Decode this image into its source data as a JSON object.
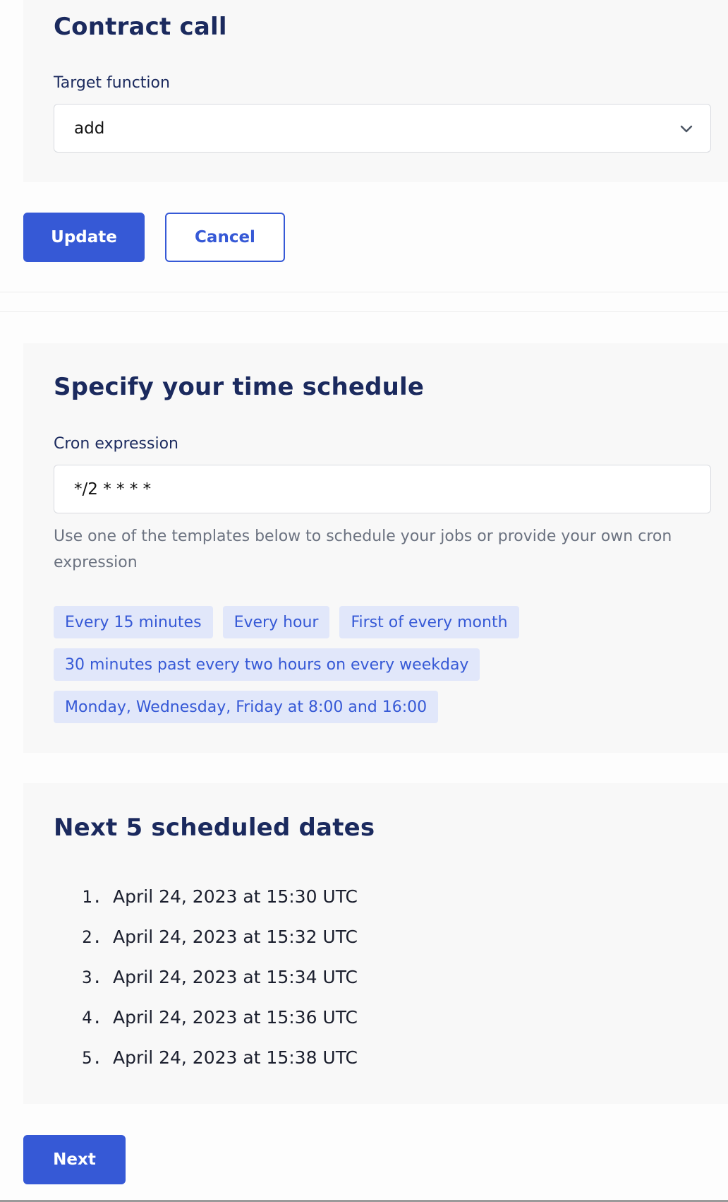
{
  "contract_call": {
    "title": "Contract call",
    "target_function_label": "Target function",
    "target_function_value": "add"
  },
  "actions": {
    "update_label": "Update",
    "cancel_label": "Cancel"
  },
  "schedule": {
    "title": "Specify your time schedule",
    "cron_label": "Cron expression",
    "cron_value": "*/2 * * * *",
    "help_text": "Use one of the templates below to schedule your jobs or provide your own cron expression",
    "templates": [
      "Every 15 minutes",
      "Every hour",
      "First of every month",
      "30 minutes past every two hours on every weekday",
      "Monday, Wednesday, Friday at 8:00 and 16:00"
    ]
  },
  "next_dates": {
    "title": "Next 5 scheduled dates",
    "items": [
      {
        "num": "1.",
        "date": "April 24, 2023 at 15:30 UTC"
      },
      {
        "num": "2.",
        "date": "April 24, 2023 at 15:32 UTC"
      },
      {
        "num": "3.",
        "date": "April 24, 2023 at 15:34 UTC"
      },
      {
        "num": "4.",
        "date": "April 24, 2023 at 15:36 UTC"
      },
      {
        "num": "5.",
        "date": "April 24, 2023 at 15:38 UTC"
      }
    ]
  },
  "footer": {
    "next_label": "Next"
  },
  "colors": {
    "primary": "#3659d6",
    "heading": "#1b2a5e",
    "chip_bg": "#e1e7fa",
    "panel_bg": "#f8f8f8"
  },
  "icons": {
    "select_chevron": "chevron-down-icon"
  }
}
